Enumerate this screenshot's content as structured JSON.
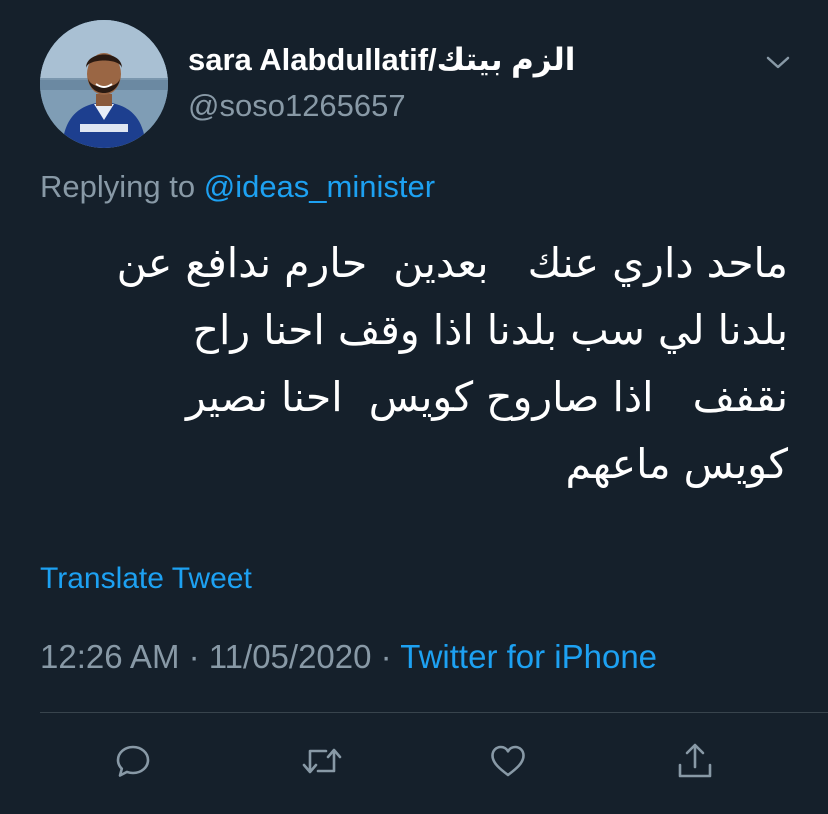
{
  "tweet": {
    "author": {
      "display_name": "sara Alabdullatif/الزم بيتك",
      "handle": "@soso1265657",
      "avatar_icon": "profile-photo-football-player"
    },
    "reply": {
      "prefix": "Replying to",
      "mention": "@ideas_minister"
    },
    "text_lines": [
      "ماحد داري عنك   بعدين  حارم ندافع عن",
      "بلدنا لي سب بلدنا اذا وقف احنا راح",
      "نقفف   اذا صاروح كويس  احنا نصير",
      "كويس ماعهم"
    ],
    "translate_label": "Translate Tweet",
    "time": "12:26 AM",
    "separator": "·",
    "date": "11/05/2020",
    "source": "Twitter for iPhone",
    "actions": [
      {
        "icon": "reply-icon"
      },
      {
        "icon": "retweet-icon"
      },
      {
        "icon": "like-icon"
      },
      {
        "icon": "share-icon"
      }
    ]
  },
  "colors": {
    "background": "#15202b",
    "primary_text": "#ffffff",
    "secondary_text": "#8899a6",
    "accent": "#1da1f2",
    "divider": "#38444d"
  }
}
